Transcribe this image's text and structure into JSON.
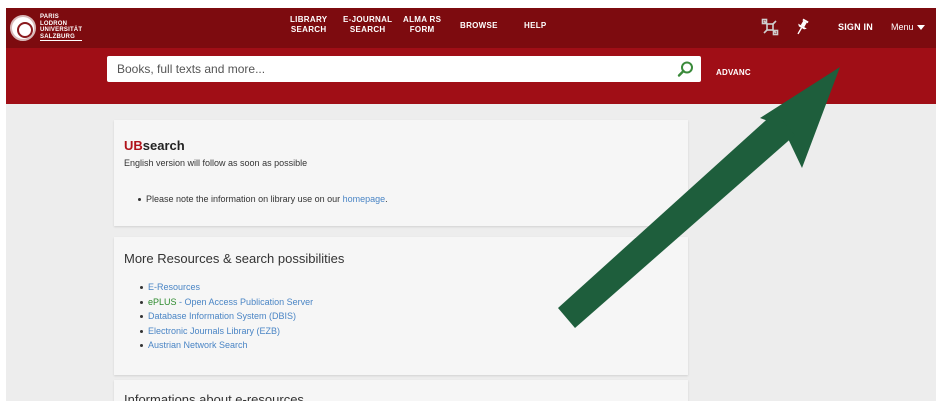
{
  "header": {
    "logo_lines": [
      "PARIS",
      "LODRON",
      "UNIVERSITÄT",
      "SALZBURG"
    ],
    "nav": [
      {
        "id": "library-search",
        "label": "LIBRARY\nSEARCH"
      },
      {
        "id": "e-journal-search",
        "label": "E-JOURNAL\nSEARCH"
      },
      {
        "id": "alma-rs-form",
        "label": "ALMA RS\nFORM"
      },
      {
        "id": "browse",
        "label": "BROWSE"
      },
      {
        "id": "help",
        "label": "HELP"
      }
    ],
    "sign_in": "SIGN IN",
    "menu": "Menu",
    "icons": [
      "satellite-icon",
      "pin-icon",
      "chevron-down-icon"
    ]
  },
  "search": {
    "placeholder": "Books, full texts and more...",
    "advanced_label": "ADVANC"
  },
  "ubsearch_card": {
    "title_prefix": "UB",
    "title_suffix": "search",
    "subtitle": "English version will follow as soon as possible",
    "note_text": "Please note the information on library use on our ",
    "note_link": "homepage",
    "note_end": "."
  },
  "resources_card": {
    "heading": "More Resources & search possibilities",
    "items": [
      "E-Resources",
      "ePLUS",
      " - Open Access Publication Server",
      "Database Information System (DBIS)",
      "Electronic Journals Library (EZB)",
      "Austrian Network Search"
    ]
  },
  "eresources_card": {
    "heading": "Informations about e-resources"
  },
  "colors": {
    "topbar": "#7d0b0f",
    "searchband": "#a00e16",
    "link": "#4a85c5",
    "eplus": "#2e8b2e",
    "ub_red": "#b0121a",
    "arrow": "#1e5e3c"
  }
}
